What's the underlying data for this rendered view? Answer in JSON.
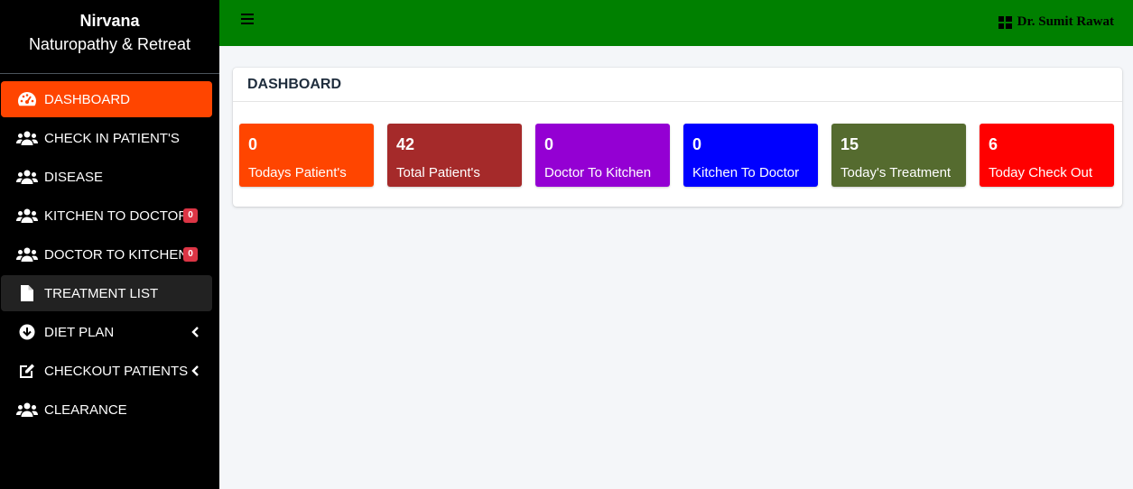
{
  "brand": {
    "title": "Nirvana",
    "subtitle": "Naturopathy & Retreat"
  },
  "sidebar": {
    "items": [
      {
        "label": "DASHBOARD",
        "icon": "tachometer-icon"
      },
      {
        "label": "CHECK IN PATIENT'S",
        "icon": "users-icon"
      },
      {
        "label": "DISEASE",
        "icon": "users-icon"
      },
      {
        "label": "KITCHEN TO DOCTOR",
        "icon": "users-icon",
        "badge": "0"
      },
      {
        "label": "DOCTOR TO KITCHEN",
        "icon": "users-icon",
        "badge": "0"
      },
      {
        "label": "TREATMENT LIST",
        "icon": "file-icon"
      },
      {
        "label": "DIET PLAN",
        "icon": "arrow-circle-down-icon"
      },
      {
        "label": "CHECKOUT PATIENTS",
        "icon": "edit-icon"
      },
      {
        "label": "CLEARANCE",
        "icon": "users-icon"
      }
    ]
  },
  "topbar": {
    "user_name": "Dr. Sumit Rawat",
    "bg_color": "#008000"
  },
  "card": {
    "title": "DASHBOARD"
  },
  "stats": [
    {
      "value": "0",
      "label": "Todays Patient's",
      "color": "#ff4500"
    },
    {
      "value": "42",
      "label": "Total Patient's",
      "color": "#a52a2a"
    },
    {
      "value": "0",
      "label": "Doctor To Kitchen",
      "color": "#9400d3"
    },
    {
      "value": "0",
      "label": "Kitchen To Doctor",
      "color": "#0000ff"
    },
    {
      "value": "15",
      "label": "Today's Treatment",
      "color": "#556b2f"
    },
    {
      "value": "6",
      "label": "Today Check Out",
      "color": "#ff0000"
    }
  ]
}
